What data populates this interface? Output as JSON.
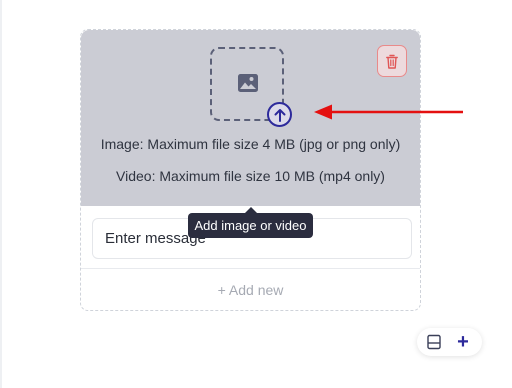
{
  "uploader": {
    "image_limit_text": "Image: Maximum file size 4 MB (jpg or png only)",
    "video_limit_text": "Video: Maximum file size 10 MB (mp4 only)",
    "upload_tooltip": "Add image or video",
    "message_placeholder": "Enter message",
    "add_new_label": "+ Add new"
  },
  "toolbar": {
    "add_label": "+"
  },
  "icons": {
    "dropzone": "image-icon",
    "upload": "arrow-up-circle-icon",
    "delete": "trash-icon",
    "layout": "layout-split-icon"
  },
  "colors": {
    "accent": "#2d2a9b",
    "media_background": "#cbccd4",
    "delete": "#e05555",
    "tooltip_background": "#2b2d3f",
    "annotation_arrow": "#e41010"
  }
}
